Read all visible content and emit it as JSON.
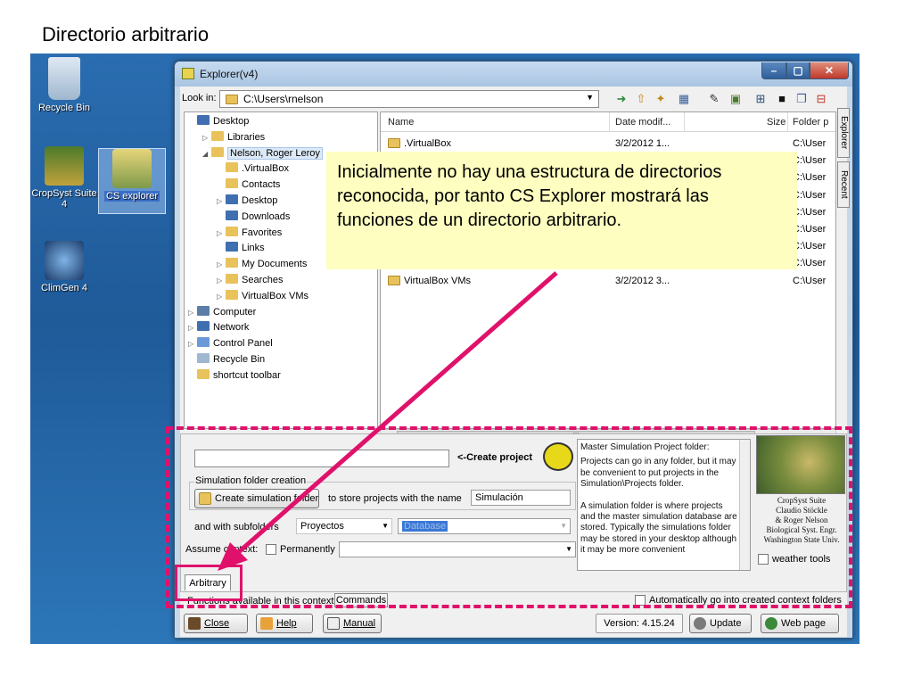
{
  "slide": {
    "title": "Directorio arbitrario"
  },
  "desktop": {
    "icons": [
      {
        "label": "Recycle Bin"
      },
      {
        "label": "CropSyst Suite 4"
      },
      {
        "label": "CS explorer"
      },
      {
        "label": "ClimGen 4"
      }
    ]
  },
  "window": {
    "title": "Explorer(v4)",
    "lookin_label": "Look in:",
    "lookin_path": "C:\\Users\\rnelson",
    "side_tabs": [
      "Explorer",
      "Recent"
    ]
  },
  "tree": [
    {
      "label": "Desktop",
      "depth": 0,
      "expander": "",
      "icon_color": "#3f6fb0"
    },
    {
      "label": "Libraries",
      "depth": 1,
      "expander": "▷",
      "icon_color": "#e8c25a"
    },
    {
      "label": "Nelson, Roger Leroy",
      "depth": 1,
      "expander": "◢",
      "icon_color": "#e8c25a",
      "selected": true
    },
    {
      "label": ".VirtualBox",
      "depth": 2,
      "expander": "",
      "icon_color": "#e8c25a"
    },
    {
      "label": "Contacts",
      "depth": 2,
      "expander": "",
      "icon_color": "#e8c25a"
    },
    {
      "label": "Desktop",
      "depth": 2,
      "expander": "▷",
      "icon_color": "#3f6fb0"
    },
    {
      "label": "Downloads",
      "depth": 2,
      "expander": "",
      "icon_color": "#3f6fb0"
    },
    {
      "label": "Favorites",
      "depth": 2,
      "expander": "▷",
      "icon_color": "#e8c25a"
    },
    {
      "label": "Links",
      "depth": 2,
      "expander": "",
      "icon_color": "#3f6fb0"
    },
    {
      "label": "My Documents",
      "depth": 2,
      "expander": "▷",
      "icon_color": "#e8c25a"
    },
    {
      "label": "Searches",
      "depth": 2,
      "expander": "▷",
      "icon_color": "#e8c25a"
    },
    {
      "label": "VirtualBox VMs",
      "depth": 2,
      "expander": "▷",
      "icon_color": "#e8c25a"
    },
    {
      "label": "Computer",
      "depth": 0,
      "expander": "▷",
      "icon_color": "#5b7ea8"
    },
    {
      "label": "Network",
      "depth": 0,
      "expander": "▷",
      "icon_color": "#3f6fb0"
    },
    {
      "label": "Control Panel",
      "depth": 0,
      "expander": "▷",
      "icon_color": "#6c9ad8"
    },
    {
      "label": "Recycle Bin",
      "depth": 0,
      "expander": "",
      "icon_color": "#9fb7cf"
    },
    {
      "label": "shortcut toolbar",
      "depth": 0,
      "expander": "",
      "icon_color": "#e8c25a"
    }
  ],
  "file_list": {
    "columns": [
      "Name",
      "Date modif...",
      "Size",
      "Folder p"
    ],
    "rows": [
      {
        "name": ".VirtualBox",
        "date": "3/2/2012 1...",
        "folder": "C:\\User"
      },
      {
        "name": "",
        "date": "",
        "folder": "C:\\User"
      },
      {
        "name": "",
        "date": "",
        "folder": "C:\\User"
      },
      {
        "name": "",
        "date": "",
        "folder": "C:\\User"
      },
      {
        "name": "",
        "date": "",
        "folder": "C:\\User"
      },
      {
        "name": "",
        "date": "",
        "folder": "C:\\User"
      },
      {
        "name": "",
        "date": "",
        "folder": "C:\\User"
      },
      {
        "name": "",
        "date": "",
        "folder": "C:\\User"
      },
      {
        "name": "VirtualBox VMs",
        "date": "3/2/2012 3...",
        "folder": "C:\\User"
      }
    ],
    "scroll_thumb": "III"
  },
  "callout": {
    "text": "Inicialmente no hay una estructura de directorios reconocida, por tanto CS Explorer mostrará las funciones de un directorio arbitrario."
  },
  "panel": {
    "create_project_label": "<-Create project",
    "simulation_group_label": "Simulation folder creation",
    "create_sim_button": "Create simulation folder",
    "store_text": "to store projects with the name",
    "sim_name_value": "Simulación",
    "subfolders_label": "and  with subfolders",
    "subfolder_value": "Proyectos",
    "database_value": "Database",
    "assume_context_label": "Assume context:",
    "permanently_label": "Permanently",
    "info_paragraphs": [
      "Master Simulation Project folder:",
      "Projects can go in any folder, but it may be convenient to put projects in the Simulation\\Projects folder.",
      "A simulation folder is where projects and the master simulation  database are stored.  Typically the simulations folder may be stored in your desktop although it may be more convenient"
    ],
    "logo_lines": [
      "CropSyst Suite",
      "Claudio Stöckle",
      "& Roger Nelson",
      "Biological Syst. Engr.",
      "Washington State Univ."
    ],
    "weather_tools_label": "weather tools",
    "tab_arbitrary": "Arbitrary",
    "functions_label": "Functions available in this context",
    "tab_commands": "Commands",
    "auto_go_label": "Automatically go into created context folders"
  },
  "bottombar": {
    "close": "Close",
    "help": "Help",
    "manual": "Manual",
    "version": "Version: 4.15.24",
    "update": "Update",
    "webpage": "Web page"
  }
}
